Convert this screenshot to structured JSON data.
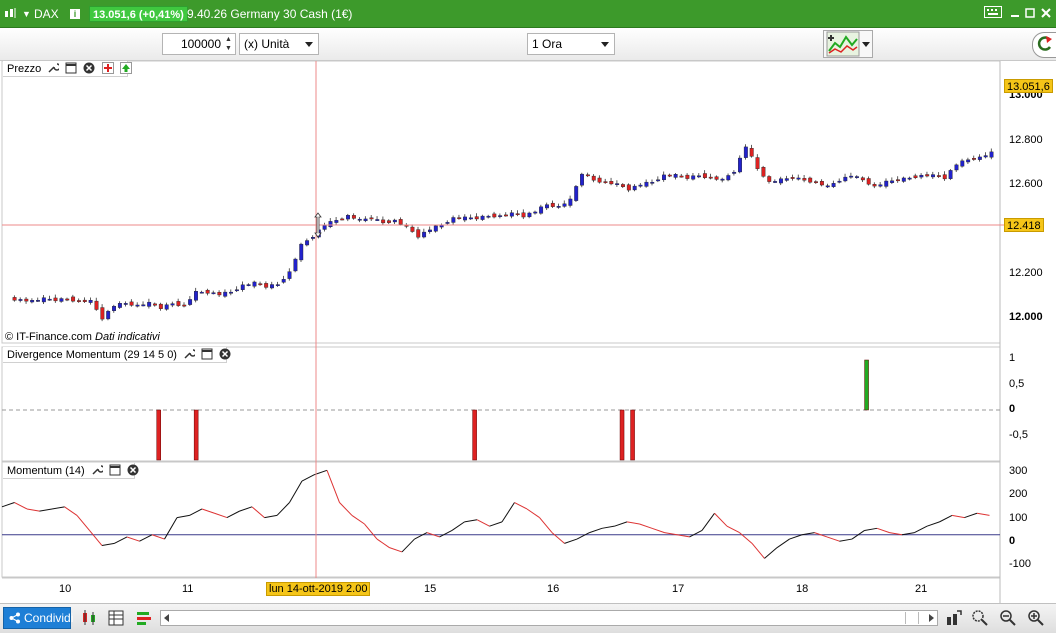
{
  "window": {
    "symbol": "DAX",
    "price_badge": "13.051,6 (+0,41%)",
    "time_title": "9.40.26 Germany 30 Cash (1€)",
    "info_glyph": "i"
  },
  "toolbar": {
    "quantity": "100000",
    "unit": "(x) Unità",
    "timeframe": "1 Ora"
  },
  "price_panel": {
    "label": "Prezzo",
    "copyright": "© IT-Finance.com",
    "notice": "Dati indicativi",
    "y_ticks": [
      "12.000",
      "12.200",
      "12.400",
      "12.600",
      "12.800",
      "13.000"
    ],
    "last_price_tag": "13.051,6",
    "crosshair_tag": "12.418"
  },
  "div_panel": {
    "label": "Divergence Momentum (29 14 5 0)",
    "y_ticks": [
      "1",
      "0,5",
      "0",
      "-0,5"
    ]
  },
  "mom_panel": {
    "label": "Momentum (14)",
    "y_ticks": [
      "300",
      "200",
      "100",
      "0",
      "-100"
    ]
  },
  "x_axis": {
    "ticks": [
      "10",
      "11",
      "15",
      "16",
      "17",
      "18",
      "21"
    ],
    "crosshair_label": "lun 14-ott-2019 2.00"
  },
  "bottom": {
    "share_label": "Condividi"
  },
  "colors": {
    "title_green": "#3d9a2b",
    "badge_green": "#3fc83f",
    "bull_candle": "#2222cc",
    "bear_candle": "#dd2222",
    "crosshair": "#ee8888",
    "price_tag": "#f5c518",
    "signal_green": "#22aa22",
    "signal_red": "#dd2222"
  },
  "chart_data": [
    {
      "type": "candlestick",
      "title": "Prezzo",
      "x_labels": [
        "10",
        "11",
        "15",
        "16",
        "17",
        "18",
        "21"
      ],
      "ylim": [
        11950,
        13100
      ],
      "close_path": [
        [
          0,
          12120
        ],
        [
          2,
          12110
        ],
        [
          3,
          12120
        ],
        [
          4,
          12115
        ],
        [
          5,
          12120
        ],
        [
          6,
          12110
        ],
        [
          7,
          12110
        ],
        [
          8,
          12035
        ],
        [
          9,
          12090
        ],
        [
          10,
          12100
        ],
        [
          11,
          12090
        ],
        [
          12,
          12100
        ],
        [
          13,
          12080
        ],
        [
          14,
          12100
        ],
        [
          15,
          12090
        ],
        [
          16,
          12150
        ],
        [
          17,
          12150
        ],
        [
          18,
          12140
        ],
        [
          19,
          12150
        ],
        [
          20,
          12180
        ],
        [
          21,
          12190
        ],
        [
          22,
          12175
        ],
        [
          23,
          12185
        ],
        [
          24,
          12240
        ],
        [
          25,
          12360
        ],
        [
          26,
          12400
        ],
        [
          27,
          12450
        ],
        [
          28,
          12470
        ],
        [
          29,
          12490
        ],
        [
          30,
          12470
        ],
        [
          31,
          12480
        ],
        [
          32,
          12460
        ],
        [
          33,
          12470
        ],
        [
          34,
          12440
        ],
        [
          35,
          12400
        ],
        [
          36,
          12430
        ],
        [
          37,
          12450
        ],
        [
          38,
          12480
        ],
        [
          39,
          12480
        ],
        [
          40,
          12480
        ],
        [
          41,
          12490
        ],
        [
          42,
          12490
        ],
        [
          43,
          12500
        ],
        [
          44,
          12490
        ],
        [
          45,
          12510
        ],
        [
          46,
          12540
        ],
        [
          47,
          12530
        ],
        [
          48,
          12560
        ],
        [
          49,
          12680
        ],
        [
          50,
          12650
        ],
        [
          51,
          12640
        ],
        [
          52,
          12630
        ],
        [
          53,
          12610
        ],
        [
          54,
          12630
        ],
        [
          55,
          12640
        ],
        [
          56,
          12670
        ],
        [
          57,
          12670
        ],
        [
          58,
          12660
        ],
        [
          59,
          12670
        ],
        [
          60,
          12660
        ],
        [
          61,
          12650
        ],
        [
          62,
          12690
        ],
        [
          63,
          12800
        ],
        [
          64,
          12700
        ],
        [
          65,
          12640
        ],
        [
          66,
          12650
        ],
        [
          67,
          12660
        ],
        [
          68,
          12650
        ],
        [
          69,
          12640
        ],
        [
          70,
          12620
        ],
        [
          71,
          12650
        ],
        [
          72,
          12670
        ],
        [
          73,
          12650
        ],
        [
          74,
          12620
        ],
        [
          75,
          12640
        ],
        [
          76,
          12650
        ],
        [
          77,
          12660
        ],
        [
          78,
          12670
        ],
        [
          79,
          12670
        ],
        [
          80,
          12660
        ],
        [
          81,
          12720
        ],
        [
          82,
          12740
        ],
        [
          83,
          12750
        ],
        [
          84,
          12770
        ]
      ]
    },
    {
      "type": "bar",
      "title": "Divergence Momentum (29 14 5 0)",
      "ylim": [
        -1,
        1
      ],
      "bars": [
        {
          "x": 11.6,
          "value": -1
        },
        {
          "x": 14.8,
          "value": -1
        },
        {
          "x": 38.6,
          "value": -1
        },
        {
          "x": 51.2,
          "value": -1
        },
        {
          "x": 52.1,
          "value": -1
        },
        {
          "x": 72.1,
          "value": 1
        }
      ]
    },
    {
      "type": "line",
      "title": "Momentum (14)",
      "ylim": [
        -150,
        320
      ],
      "points": [
        [
          0,
          130
        ],
        [
          1,
          150
        ],
        [
          2,
          120
        ],
        [
          3,
          110
        ],
        [
          4,
          120
        ],
        [
          5,
          130
        ],
        [
          6,
          90
        ],
        [
          7,
          20
        ],
        [
          8,
          -50
        ],
        [
          9,
          -40
        ],
        [
          10,
          -10
        ],
        [
          11,
          -30
        ],
        [
          12,
          0
        ],
        [
          13,
          -20
        ],
        [
          14,
          80
        ],
        [
          15,
          90
        ],
        [
          16,
          120
        ],
        [
          17,
          100
        ],
        [
          18,
          80
        ],
        [
          19,
          110
        ],
        [
          20,
          130
        ],
        [
          21,
          80
        ],
        [
          22,
          90
        ],
        [
          23,
          150
        ],
        [
          24,
          250
        ],
        [
          25,
          280
        ],
        [
          26,
          300
        ],
        [
          27,
          150
        ],
        [
          28,
          90
        ],
        [
          29,
          50
        ],
        [
          30,
          -20
        ],
        [
          31,
          -60
        ],
        [
          32,
          -80
        ],
        [
          33,
          -20
        ],
        [
          34,
          10
        ],
        [
          35,
          -10
        ],
        [
          36,
          20
        ],
        [
          37,
          60
        ],
        [
          38,
          70
        ],
        [
          39,
          40
        ],
        [
          40,
          60
        ],
        [
          41,
          150
        ],
        [
          42,
          120
        ],
        [
          43,
          80
        ],
        [
          44,
          10
        ],
        [
          45,
          -40
        ],
        [
          46,
          -20
        ],
        [
          47,
          10
        ],
        [
          48,
          30
        ],
        [
          49,
          40
        ],
        [
          50,
          60
        ],
        [
          51,
          50
        ],
        [
          52,
          30
        ],
        [
          53,
          10
        ],
        [
          54,
          0
        ],
        [
          55,
          -10
        ],
        [
          56,
          20
        ],
        [
          57,
          100
        ],
        [
          58,
          40
        ],
        [
          59,
          10
        ],
        [
          60,
          -40
        ],
        [
          61,
          -110
        ],
        [
          62,
          -60
        ],
        [
          63,
          -20
        ],
        [
          64,
          0
        ],
        [
          65,
          10
        ],
        [
          66,
          -10
        ],
        [
          67,
          -30
        ],
        [
          68,
          -20
        ],
        [
          69,
          20
        ],
        [
          70,
          30
        ],
        [
          71,
          10
        ],
        [
          72,
          0
        ],
        [
          73,
          10
        ],
        [
          74,
          40
        ],
        [
          75,
          60
        ],
        [
          76,
          90
        ],
        [
          77,
          80
        ],
        [
          78,
          100
        ],
        [
          79,
          90
        ]
      ],
      "zero_line": true
    }
  ]
}
